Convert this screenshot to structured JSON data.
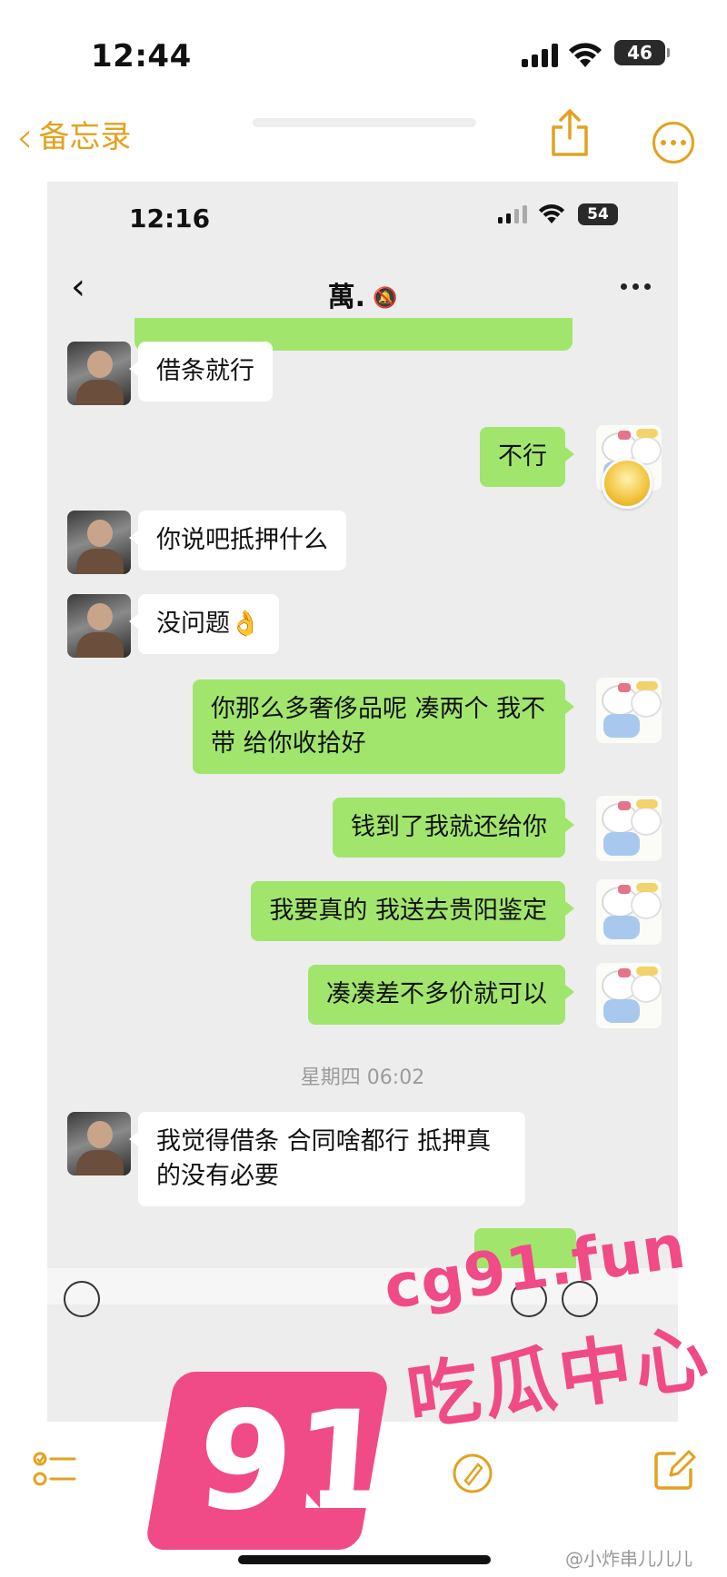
{
  "outer_status": {
    "time": "12:44",
    "battery": "46"
  },
  "notes_header": {
    "back_label": "备忘录"
  },
  "inner_status": {
    "time": "12:16",
    "battery": "54"
  },
  "chat": {
    "title": "萬.",
    "messages": [
      {
        "side": "left",
        "text": "借条就行"
      },
      {
        "side": "right",
        "text": "不行"
      },
      {
        "side": "left",
        "text": "你说吧抵押什么"
      },
      {
        "side": "left",
        "text": "没问题👌"
      },
      {
        "side": "right",
        "text": "你那么多奢侈品呢 凑两个 我不带 给你收拾好"
      },
      {
        "side": "right",
        "text": "钱到了我就还给你"
      },
      {
        "side": "right",
        "text": "我要真的 我送去贵阳鉴定"
      },
      {
        "side": "right",
        "text": "凑凑差不多价就可以"
      },
      {
        "side": "left",
        "text": "我觉得借条 合同啥都行   抵押真的没有必要"
      }
    ],
    "timestamp": "星期四 06:02"
  },
  "watermark": {
    "logo_number": "91",
    "url": "cg91.fun",
    "name": "吃瓜中心",
    "credit": "@小炸串儿儿儿"
  },
  "colors": {
    "accent": "#e2a220",
    "bubble_green": "#a2e56d",
    "watermark_pink": "#f04b86"
  }
}
